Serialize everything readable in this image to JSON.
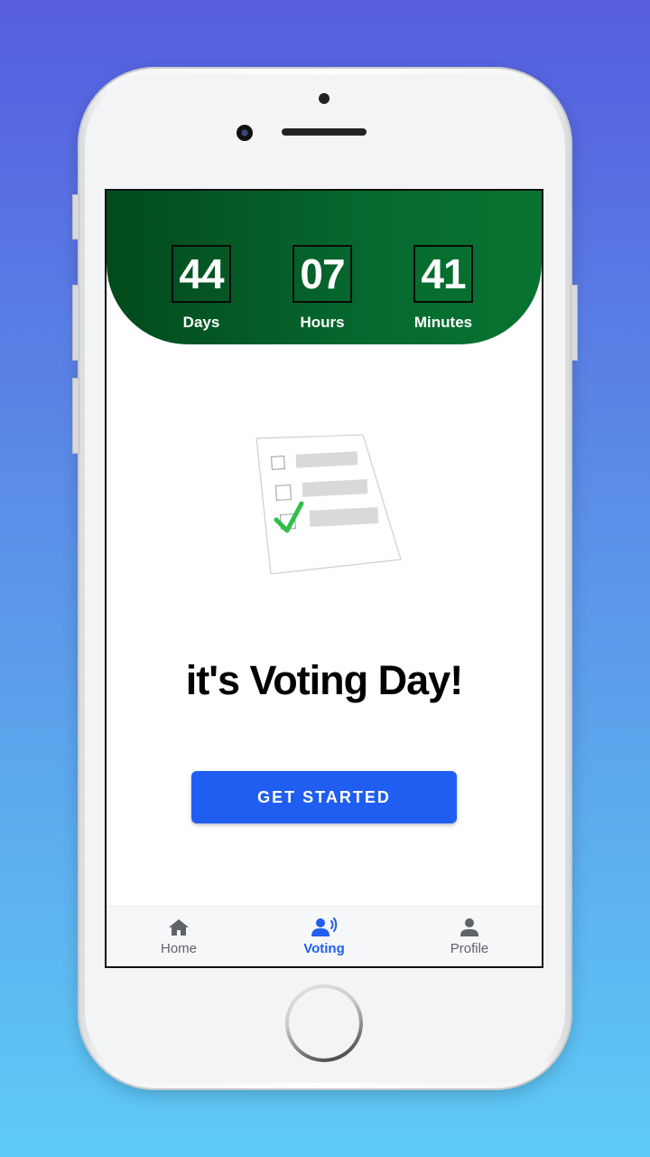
{
  "countdown": {
    "days": {
      "value": "44",
      "label": "Days"
    },
    "hours": {
      "value": "07",
      "label": "Hours"
    },
    "minutes": {
      "value": "41",
      "label": "Minutes"
    }
  },
  "illustration": {
    "icon": "ballot-checklist-icon",
    "check_color": "#2fbf4a"
  },
  "headline": "it's Voting Day!",
  "cta": {
    "label": "GET STARTED",
    "color": "#1f5ef0"
  },
  "bottom_nav": {
    "items": [
      {
        "label": "Home",
        "icon": "home-icon",
        "active": false
      },
      {
        "label": "Voting",
        "icon": "voting-icon",
        "active": true
      },
      {
        "label": "Profile",
        "icon": "profile-icon",
        "active": false
      }
    ]
  },
  "colors": {
    "header_start": "#024a1c",
    "header_end": "#077431",
    "accent": "#1f5ef0",
    "background_top": "#565ddf",
    "background_bottom": "#5ecbf6"
  }
}
